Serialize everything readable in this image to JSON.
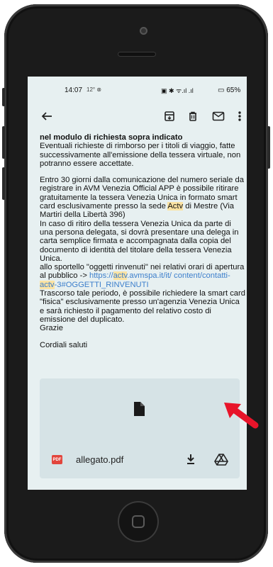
{
  "statusbar": {
    "time": "14:07",
    "left_icons": "12° ⊗",
    "right_icons": "▣ ✱ ᯤ.ıl .ıl",
    "battery": "▭ 65%"
  },
  "toolbar": {
    "back_icon": "arrow-left-icon",
    "archive_icon": "archive-icon",
    "delete_icon": "trash-icon",
    "mail_icon": "mail-icon",
    "more_icon": "more-vert-icon"
  },
  "email": {
    "para1_bold": "nel modulo di richiesta sopra indicato",
    "para1_text": "Eventuali richieste di rimborso per i titoli di viaggio, fatte successivamente all'emissione della tessera virtuale, non potranno essere accettate.",
    "para2_a": "Entro 30 giorni dalla comunicazione del numero seriale da registrare in AVM Venezia Official APP è possibile ritirare gratuitamente la tessera Venezia Unica in formato smart card esclusivamente presso la sede ",
    "para2_hl1": "Actv",
    "para2_b": " di Mestre (Via Martiri della Libertà 396)",
    "para2_c": "In caso di ritiro della tessera Venezia Unica da parte di una persona delegata, si dovrà presentare una delega in carta semplice firmata e accompagnata dalla copia del documento di identità del titolare della tessera Venezia Unica.",
    "para2_d": "allo sportello \"oggetti rinvenuti\" nei relativi orari di apertura al pubblico -> ",
    "link_a": "https://",
    "link_hl1": "actv",
    "link_b": ".avmspa.it/it/ content/contatti-",
    "link_hl2": "actv",
    "link_c": "-3#OGGETTI_RINVENUTI",
    "para2_e": "Trascorso tale periodo, è possibile richiedere la smart card \"fisica\" esclusivamente presso un'agenzia Venezia Unica e sarà richiesto il pagamento del relativo costo di emissione del duplicato.",
    "thanks": "Grazie",
    "closing": "Cordiali saluti"
  },
  "attachment": {
    "badge": "PDF",
    "filename": "allegato.pdf",
    "preview_icon": "document-icon",
    "download_icon": "download-icon",
    "drive_icon": "google-drive-icon"
  },
  "colors": {
    "screen_bg": "#e7f0f1",
    "highlight": "#fbe3a3",
    "link": "#3d7fcc",
    "attachment_bg": "#d6e3e6",
    "arrow": "#e8142a"
  }
}
